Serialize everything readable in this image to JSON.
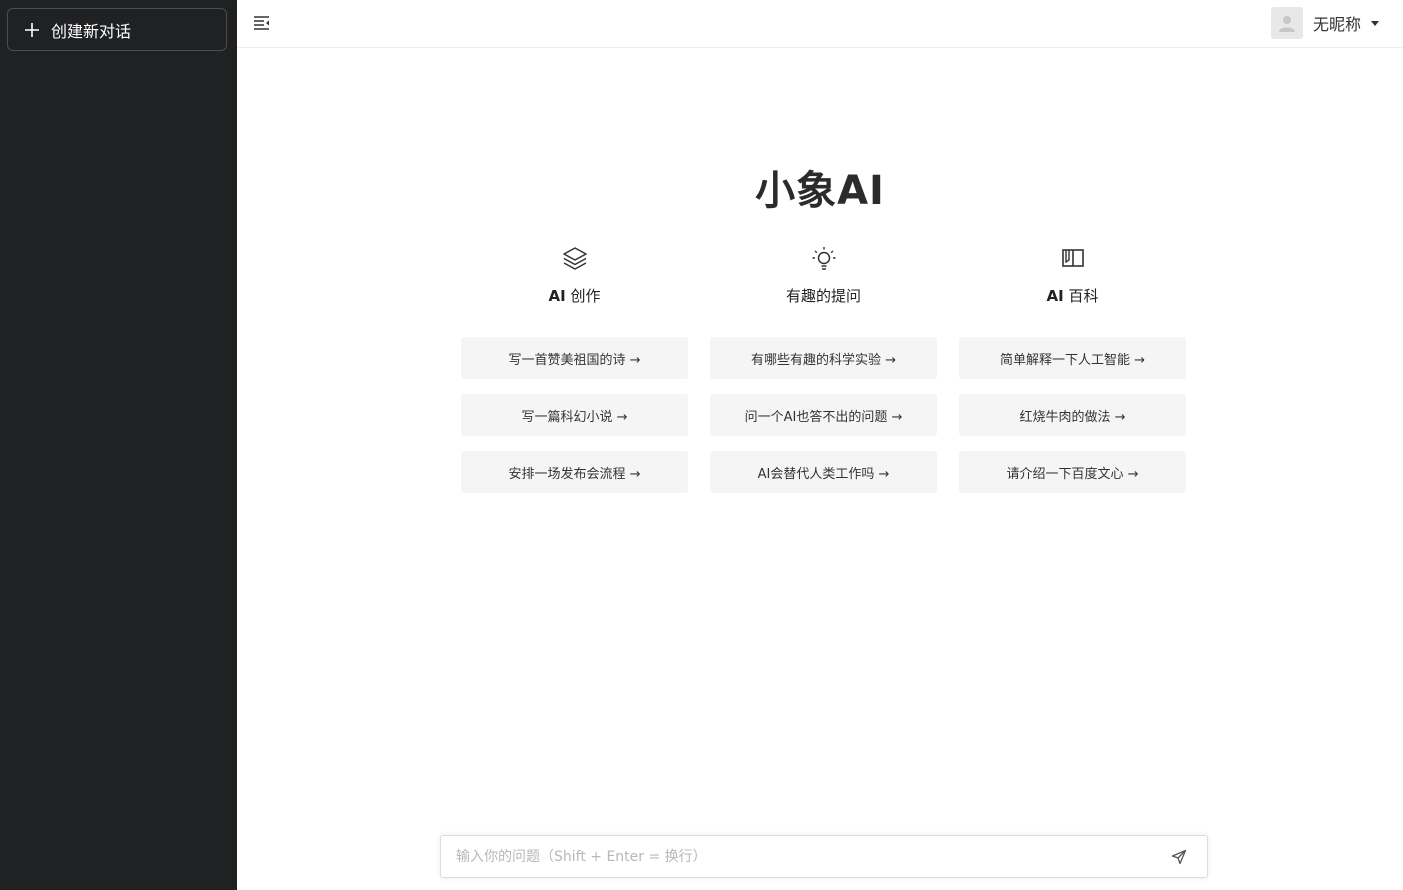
{
  "sidebar": {
    "new_chat_label": "创建新对话"
  },
  "header": {
    "username": "无昵称"
  },
  "main": {
    "title": "小象AI",
    "columns": [
      {
        "icon": "layers-icon",
        "title_bold": "AI",
        "title_rest": " 创作",
        "suggestions": [
          "写一首赞美祖国的诗 →",
          "写一篇科幻小说 →",
          "安排一场发布会流程 →"
        ]
      },
      {
        "icon": "lightbulb-icon",
        "title_bold": "",
        "title_rest": "有趣的提问",
        "suggestions": [
          "有哪些有趣的科学实验 →",
          "问一个AI也答不出的问题 →",
          "AI会替代人类工作吗 →"
        ]
      },
      {
        "icon": "book-icon",
        "title_bold": "AI",
        "title_rest": " 百科",
        "suggestions": [
          "简单解释一下人工智能 →",
          "红烧牛肉的做法 →",
          "请介绍一下百度文心 →"
        ]
      }
    ]
  },
  "input": {
    "placeholder": "输入你的问题（Shift + Enter = 换行）",
    "value": ""
  },
  "colors": {
    "sidebar_bg": "#202123",
    "suggestion_bg": "#f5f5f5"
  }
}
